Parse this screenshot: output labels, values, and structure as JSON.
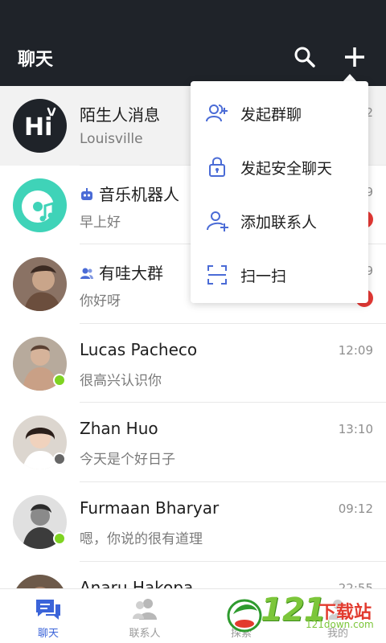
{
  "header": {
    "title": "聊天",
    "search_icon": "search-icon",
    "plus_icon": "plus-icon",
    "bg_color": "#1f2329"
  },
  "chats": [
    {
      "name": "陌生人消息",
      "preview": "Louisville",
      "time": "22",
      "avatar": "hi-avatar",
      "highlight": true
    },
    {
      "name": "音乐机器人",
      "preview": "早上好",
      "time": "9",
      "avatar": "music-avatar",
      "tag_icon": "robot-icon",
      "badge": true
    },
    {
      "name": "有哇大群",
      "preview": "你好呀",
      "time": "9",
      "avatar": "photo-avatar",
      "tag_icon": "group-icon",
      "badge": true
    },
    {
      "name": "Lucas Pacheco",
      "preview": "很高兴认识你",
      "time": "12:09",
      "avatar": "photo-avatar",
      "status": "online"
    },
    {
      "name": "Zhan Huo",
      "preview": "今天是个好日子",
      "time": "13:10",
      "avatar": "photo-avatar",
      "status": "offline"
    },
    {
      "name": "Furmaan Bharyar",
      "preview": "嗯，你说的很有道理",
      "time": "09:12",
      "avatar": "photo-avatar",
      "status": "online"
    },
    {
      "name": "Anaru Hakopa",
      "preview": "",
      "time": "22:55",
      "avatar": "photo-avatar"
    }
  ],
  "menu": {
    "items": [
      {
        "label": "发起群聊",
        "icon": "add-group-icon"
      },
      {
        "label": "发起安全聊天",
        "icon": "lock-icon"
      },
      {
        "label": "添加联系人",
        "icon": "add-contact-icon"
      },
      {
        "label": "扫一扫",
        "icon": "scan-icon"
      }
    ],
    "icon_color": "#4a6bd6"
  },
  "bottom_nav": {
    "items": [
      {
        "label": "聊天",
        "icon": "chat-icon",
        "active": true
      },
      {
        "label": "联系人",
        "icon": "contacts-icon",
        "active": false
      },
      {
        "label": "探索",
        "icon": "explore-icon",
        "active": false
      },
      {
        "label": "我的",
        "icon": "me-icon",
        "active": false
      }
    ],
    "active_color": "#3b64d9",
    "inactive_color": "#9a9a9a"
  },
  "watermark": {
    "number": "121",
    "text": "下载站",
    "url": "121down.com"
  },
  "colors": {
    "online": "#7ed321",
    "offline": "#666666",
    "badge": "#e53935"
  }
}
